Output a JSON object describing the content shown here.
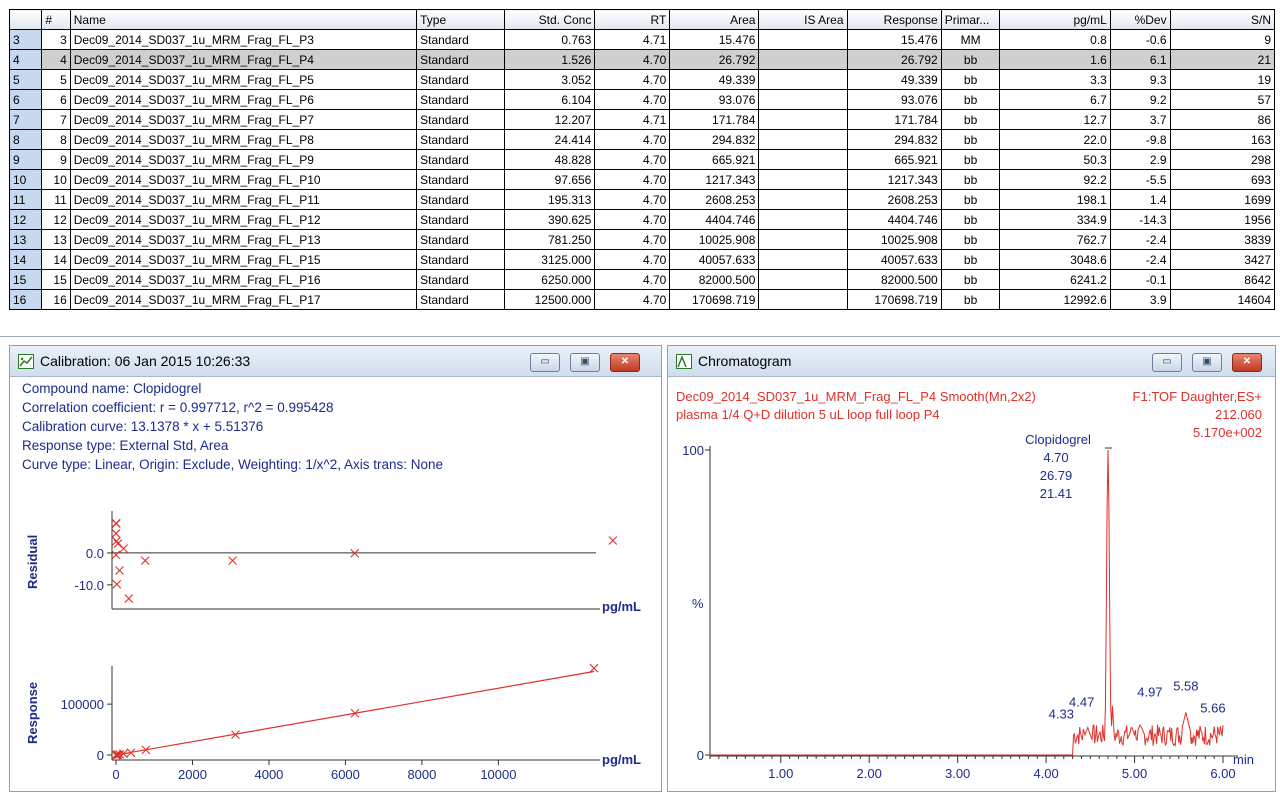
{
  "table": {
    "columns": [
      "",
      "#",
      "Name",
      "Type",
      "Std. Conc",
      "RT",
      "Area",
      "IS Area",
      "Response",
      "Primar...",
      "pg/mL",
      "%Dev",
      "S/N"
    ],
    "rows": [
      {
        "rn": "3",
        "n": "3",
        "name": "Dec09_2014_SD037_1u_MRM_Frag_FL_P3",
        "type": "Standard",
        "conc": "0.763",
        "rt": "4.71",
        "area": "15.476",
        "isarea": "",
        "resp": "15.476",
        "prim": "MM",
        "pg": "0.8",
        "dev": "-0.6",
        "sn": "9"
      },
      {
        "rn": "4",
        "n": "4",
        "name": "Dec09_2014_SD037_1u_MRM_Frag_FL_P4",
        "type": "Standard",
        "conc": "1.526",
        "rt": "4.70",
        "area": "26.792",
        "isarea": "",
        "resp": "26.792",
        "prim": "bb",
        "pg": "1.6",
        "dev": "6.1",
        "sn": "21"
      },
      {
        "rn": "5",
        "n": "5",
        "name": "Dec09_2014_SD037_1u_MRM_Frag_FL_P5",
        "type": "Standard",
        "conc": "3.052",
        "rt": "4.70",
        "area": "49.339",
        "isarea": "",
        "resp": "49.339",
        "prim": "bb",
        "pg": "3.3",
        "dev": "9.3",
        "sn": "19"
      },
      {
        "rn": "6",
        "n": "6",
        "name": "Dec09_2014_SD037_1u_MRM_Frag_FL_P6",
        "type": "Standard",
        "conc": "6.104",
        "rt": "4.70",
        "area": "93.076",
        "isarea": "",
        "resp": "93.076",
        "prim": "bb",
        "pg": "6.7",
        "dev": "9.2",
        "sn": "57"
      },
      {
        "rn": "7",
        "n": "7",
        "name": "Dec09_2014_SD037_1u_MRM_Frag_FL_P7",
        "type": "Standard",
        "conc": "12.207",
        "rt": "4.71",
        "area": "171.784",
        "isarea": "",
        "resp": "171.784",
        "prim": "bb",
        "pg": "12.7",
        "dev": "3.7",
        "sn": "86"
      },
      {
        "rn": "8",
        "n": "8",
        "name": "Dec09_2014_SD037_1u_MRM_Frag_FL_P8",
        "type": "Standard",
        "conc": "24.414",
        "rt": "4.70",
        "area": "294.832",
        "isarea": "",
        "resp": "294.832",
        "prim": "bb",
        "pg": "22.0",
        "dev": "-9.8",
        "sn": "163"
      },
      {
        "rn": "9",
        "n": "9",
        "name": "Dec09_2014_SD037_1u_MRM_Frag_FL_P9",
        "type": "Standard",
        "conc": "48.828",
        "rt": "4.70",
        "area": "665.921",
        "isarea": "",
        "resp": "665.921",
        "prim": "bb",
        "pg": "50.3",
        "dev": "2.9",
        "sn": "298"
      },
      {
        "rn": "10",
        "n": "10",
        "name": "Dec09_2014_SD037_1u_MRM_Frag_FL_P10",
        "type": "Standard",
        "conc": "97.656",
        "rt": "4.70",
        "area": "1217.343",
        "isarea": "",
        "resp": "1217.343",
        "prim": "bb",
        "pg": "92.2",
        "dev": "-5.5",
        "sn": "693"
      },
      {
        "rn": "11",
        "n": "11",
        "name": "Dec09_2014_SD037_1u_MRM_Frag_FL_P11",
        "type": "Standard",
        "conc": "195.313",
        "rt": "4.70",
        "area": "2608.253",
        "isarea": "",
        "resp": "2608.253",
        "prim": "bb",
        "pg": "198.1",
        "dev": "1.4",
        "sn": "1699"
      },
      {
        "rn": "12",
        "n": "12",
        "name": "Dec09_2014_SD037_1u_MRM_Frag_FL_P12",
        "type": "Standard",
        "conc": "390.625",
        "rt": "4.70",
        "area": "4404.746",
        "isarea": "",
        "resp": "4404.746",
        "prim": "bb",
        "pg": "334.9",
        "dev": "-14.3",
        "sn": "1956"
      },
      {
        "rn": "13",
        "n": "13",
        "name": "Dec09_2014_SD037_1u_MRM_Frag_FL_P13",
        "type": "Standard",
        "conc": "781.250",
        "rt": "4.70",
        "area": "10025.908",
        "isarea": "",
        "resp": "10025.908",
        "prim": "bb",
        "pg": "762.7",
        "dev": "-2.4",
        "sn": "3839"
      },
      {
        "rn": "14",
        "n": "14",
        "name": "Dec09_2014_SD037_1u_MRM_Frag_FL_P15",
        "type": "Standard",
        "conc": "3125.000",
        "rt": "4.70",
        "area": "40057.633",
        "isarea": "",
        "resp": "40057.633",
        "prim": "bb",
        "pg": "3048.6",
        "dev": "-2.4",
        "sn": "3427"
      },
      {
        "rn": "15",
        "n": "15",
        "name": "Dec09_2014_SD037_1u_MRM_Frag_FL_P16",
        "type": "Standard",
        "conc": "6250.000",
        "rt": "4.70",
        "area": "82000.500",
        "isarea": "",
        "resp": "82000.500",
        "prim": "bb",
        "pg": "6241.2",
        "dev": "-0.1",
        "sn": "8642"
      },
      {
        "rn": "16",
        "n": "16",
        "name": "Dec09_2014_SD037_1u_MRM_Frag_FL_P17",
        "type": "Standard",
        "conc": "12500.000",
        "rt": "4.70",
        "area": "170698.719",
        "isarea": "",
        "resp": "170698.719",
        "prim": "bb",
        "pg": "12992.6",
        "dev": "3.9",
        "sn": "14604"
      }
    ],
    "selected_row": 1
  },
  "calibration": {
    "title": "Calibration: 06 Jan 2015 10:26:33",
    "lines": [
      "Compound name: Clopidogrel",
      "Correlation coefficient: r = 0.997712, r^2 = 0.995428",
      "Calibration curve: 13.1378 * x + 5.51376",
      "Response type: External Std, Area",
      "Curve type: Linear, Origin: Exclude, Weighting: 1/x^2, Axis trans: None"
    ],
    "buttons": {
      "min": "▭",
      "restore": "▣",
      "close": "✕"
    },
    "icon": "calibration-icon"
  },
  "chromatogram": {
    "title": "Chromatogram",
    "header_left_1": "Dec09_2014_SD037_1u_MRM_Frag_FL_P4 Smooth(Mn,2x2)",
    "header_left_2": "plasma 1/4 Q+D dilution 5 uL loop full loop P4",
    "header_right_1": "F1:TOF Daughter,ES+",
    "header_right_2": "212.060",
    "header_right_3": "5.170e+002",
    "buttons": {
      "min": "▭",
      "restore": "▣",
      "close": "✕"
    },
    "icon": "chromatogram-icon"
  },
  "chart_data": [
    {
      "type": "scatter",
      "title": "",
      "xlabel": "pg/mL",
      "ylabel": "Residual",
      "yticks": [
        "0.0",
        "-10.0"
      ],
      "ylim": [
        -16,
        10
      ],
      "xlim": [
        0,
        12500
      ],
      "x": [
        12.7,
        22.0,
        50.3,
        92.2,
        198.1,
        334.9,
        762.7,
        3048.6,
        6241.2,
        12992.6,
        0.8,
        1.6,
        3.3,
        6.7
      ],
      "y": [
        3.7,
        -9.8,
        2.9,
        -5.5,
        1.4,
        -14.3,
        -2.4,
        -2.4,
        -0.1,
        3.9,
        -0.6,
        6.1,
        9.3,
        9.2
      ],
      "color": "#e0302a",
      "line_color": "#333333"
    },
    {
      "type": "scatter",
      "title": "",
      "xlabel": "pg/mL",
      "ylabel": "Response",
      "yticks": [
        "100000",
        "0"
      ],
      "xticks": [
        "0",
        "2000",
        "4000",
        "6000",
        "8000",
        "10000"
      ],
      "xlim": [
        0,
        12500
      ],
      "ylim": [
        0,
        175000
      ],
      "x": [
        0.763,
        1.526,
        3.052,
        6.104,
        12.207,
        24.414,
        48.828,
        97.656,
        195.313,
        390.625,
        781.25,
        3125,
        6250,
        12500
      ],
      "y": [
        15.476,
        26.792,
        49.339,
        93.076,
        171.784,
        294.832,
        665.921,
        1217.343,
        2608.253,
        4404.746,
        10025.908,
        40057.633,
        82000.5,
        170698.719
      ],
      "fit": {
        "slope": 13.1378,
        "intercept": 5.51376
      },
      "color": "#e0302a"
    },
    {
      "type": "line",
      "title": "",
      "xlabel": "min",
      "ylabel": "%",
      "yticks": [
        "100",
        "0"
      ],
      "xticks": [
        "1.00",
        "2.00",
        "3.00",
        "4.00",
        "5.00",
        "6.00"
      ],
      "xlim": [
        0.2,
        6.0
      ],
      "ylim": [
        0,
        100
      ],
      "peak_labels": [
        {
          "rt": 4.33,
          "label": "4.33"
        },
        {
          "rt": 4.47,
          "label": "4.47"
        },
        {
          "rt": 4.97,
          "label": "4.97"
        },
        {
          "rt": 5.58,
          "label": "5.58"
        },
        {
          "rt": 5.66,
          "label": "5.66"
        }
      ],
      "main_peak": {
        "name": "Clopidogrel",
        "rt": "4.70",
        "area": "26.79",
        "sn": "21.41"
      },
      "color": "#e0302a"
    }
  ]
}
